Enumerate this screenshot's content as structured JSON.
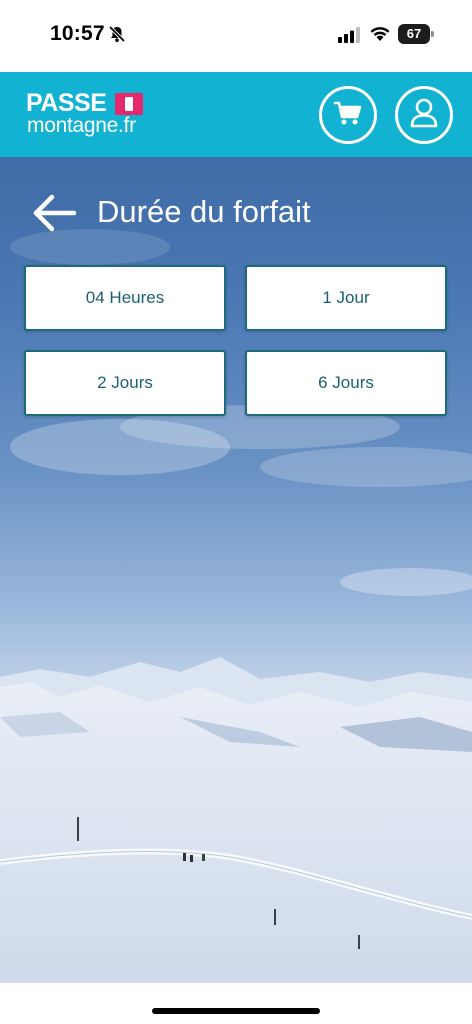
{
  "status_bar": {
    "time": "10:57",
    "battery": "67",
    "battery_level": 0.67,
    "icons": [
      "bell-off-icon",
      "signal-icon",
      "wifi-icon",
      "battery-icon"
    ]
  },
  "header": {
    "logo_top": "PASSE",
    "logo_bottom": "montagne.fr",
    "cart_icon": "shopping-cart-icon",
    "user_icon": "user-icon",
    "colors": {
      "header_bg": "#12b3d2",
      "logo_accent": "#e6286f"
    }
  },
  "page": {
    "title": "Durée du forfait",
    "back_icon": "arrow-left-icon"
  },
  "options": [
    {
      "label": "04 Heures"
    },
    {
      "label": "1 Jour"
    },
    {
      "label": "2 Jours"
    },
    {
      "label": "6 Jours"
    }
  ],
  "colors": {
    "option_text": "#1d5f73",
    "option_border": "#1d6b7a"
  }
}
